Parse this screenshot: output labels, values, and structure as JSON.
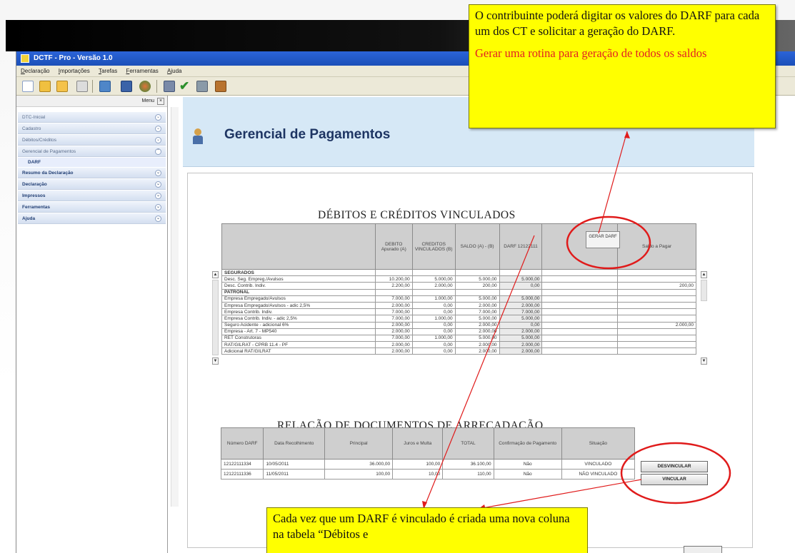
{
  "app": {
    "title": "DCTF - Pro - Versão 1.0",
    "menu": [
      "Declaração",
      "Importações",
      "Tarefas",
      "Ferramentas",
      "Ajuda"
    ]
  },
  "toolbar_icons": [
    "new-icon",
    "open-icon",
    "folder-icon",
    "delete-icon",
    "import-icon",
    "save-icon",
    "refresh-icon",
    "print-icon",
    "check-icon",
    "calculator-icon",
    "exit-icon"
  ],
  "sidebar": {
    "menu_label": "Menu",
    "items": [
      {
        "label": "DTC-Inicial",
        "bold": false
      },
      {
        "label": "Cadastro",
        "bold": false
      },
      {
        "label": "Débitos/Créditos",
        "bold": false
      },
      {
        "label": "Gerencial de Pagamentos",
        "bold": false
      },
      {
        "label": "DARF",
        "sub": true
      },
      {
        "label": "Resumo da Declaração",
        "bold": true
      },
      {
        "label": "Declaração",
        "bold": true
      },
      {
        "label": "Impressos",
        "bold": true
      },
      {
        "label": "Ferramentas",
        "bold": true
      },
      {
        "label": "Ajuda",
        "bold": true
      }
    ]
  },
  "page": {
    "title": "Gerencial de Pagamentos"
  },
  "debitos": {
    "title": "DÉBITOS E CRÉDITOS VINCULADOS",
    "headers": [
      "",
      "DEBITO Apurado (A)",
      "CREDITOS VINCULADOS (B)",
      "SALDO (A) - (B)",
      "DARF 12122111",
      "",
      "Saldo a Pagar"
    ],
    "gerar_label": "GERAR DARF",
    "rows": [
      {
        "c": [
          "SEGURADOS",
          "",
          "",
          "",
          "",
          "",
          ""
        ],
        "sec": true
      },
      {
        "c": [
          "Desc. Seg. Empreg./Avulsos",
          "10.200,00",
          "5.000,00",
          "5.000,00",
          "5.000,00",
          "",
          ""
        ]
      },
      {
        "c": [
          "Desc. Contrib. Indiv.",
          "2.200,00",
          "2.000,00",
          "200,00",
          "0,00",
          "",
          "200,00"
        ]
      },
      {
        "c": [
          "PATRONAL",
          "",
          "",
          "",
          "",
          "",
          ""
        ],
        "sec": true
      },
      {
        "c": [
          "Empresa Empregado/Avulsos",
          "7.000,00",
          "1.000,00",
          "5.000,00",
          "5.000,00",
          "",
          ""
        ]
      },
      {
        "c": [
          "Empresa Empregado/Avulsos - adic 2,5%",
          "2.000,00",
          "0,00",
          "2.000,00",
          "2.000,00",
          "",
          ""
        ]
      },
      {
        "c": [
          "Empresa Contrib. Indiv.",
          "7.000,00",
          "0,00",
          "7.000,00",
          "7.000,00",
          "",
          ""
        ]
      },
      {
        "c": [
          "Empresa Contrib. Indiv. - adic 2,5%",
          "7.000,00",
          "1.000,00",
          "5.000,00",
          "5.000,00",
          "",
          ""
        ]
      },
      {
        "c": [
          "Seguro Acidente - adicional 6%",
          "2.000,00",
          "0,00",
          "2.000,00",
          "0,00",
          "",
          "2.000,00"
        ]
      },
      {
        "c": [
          "Empresa - Art. 7 - MP540",
          "2.000,00",
          "0,00",
          "2.000,00",
          "2.000,00",
          "",
          ""
        ]
      },
      {
        "c": [
          "RET Construtoras",
          "7.000,00",
          "1.000,00",
          "5.000,00",
          "5.000,00",
          "",
          ""
        ]
      },
      {
        "c": [
          "RAT/GILRAT - CPRB 11.4 - PF",
          "2.000,00",
          "0,00",
          "2.000,00",
          "2.000,00",
          "",
          ""
        ]
      },
      {
        "c": [
          "Adicional RAT/GILRAT",
          "2.000,00",
          "0,00",
          "2.000,00",
          "2.000,00",
          "",
          ""
        ]
      }
    ]
  },
  "relacao": {
    "title": "RELAÇÃO DE DOCUMENTOS DE ARRECADAÇÃO",
    "headers": [
      "Número DARF",
      "Data Recolhimento",
      "Principal",
      "Juros e Multa",
      "TOTAL",
      "Confirmação de Pagamento",
      "Situação"
    ],
    "rows": [
      [
        "12122111334",
        "10/05/2011",
        "36.000,00",
        "100,00",
        "36.100,00",
        "Não",
        "VINCULADO"
      ],
      [
        "12122111336",
        "11/05/2011",
        "100,00",
        "10,00",
        "110,00",
        "Não",
        "NÃO VINCULADO"
      ]
    ],
    "desvincular_label": "DESVINCULAR",
    "vincular_label": "VINCULAR"
  },
  "notes": {
    "top_line1": "O contribuinte poderá digitar os valores do DARF para cada um dos CT e solicitar a geração do DARF.",
    "top_line2": "Gerar uma rotina para geração de todos os saldos",
    "bottom": "Cada vez que um DARF é vinculado é criada uma nova coluna na tabela “Débitos e"
  },
  "colors": {
    "note_bg": "#ffff00",
    "note_red": "#e32222",
    "annotation_red": "#e01b1b",
    "title_blue": "#1e3563",
    "header_bg": "#d6e8f6"
  }
}
